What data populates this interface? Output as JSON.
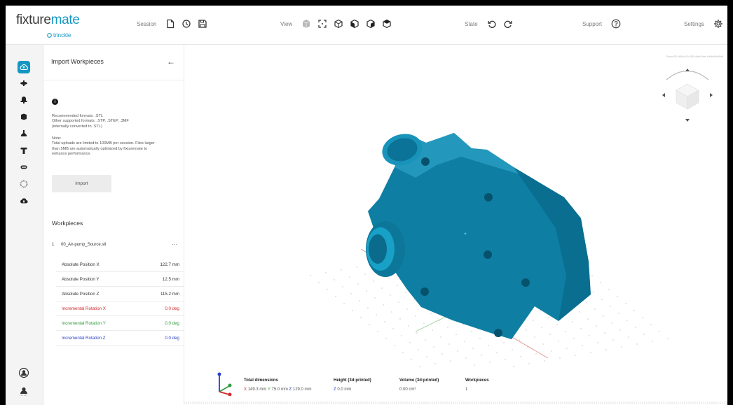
{
  "app": {
    "logo_main": "fixture",
    "logo_accent": "mate",
    "logo_sub": "trinckle"
  },
  "toolbar": {
    "session_label": "Session",
    "view_label": "View",
    "state_label": "State",
    "support_label": "Support",
    "settings_label": "Settings"
  },
  "panel": {
    "title": "Import Workpieces",
    "back_icon": "←",
    "info_icon": "i",
    "formats_lines": [
      "Recommended formats: .STL",
      "Other supported formats: .STP, .STEP, .3MF",
      "(internally converted to .STL)"
    ],
    "note_lines": [
      "Note:",
      "Total uploads are limited to 100MB per session. Files larger",
      "than 5MB are automatically optimized by fixturemate to",
      "enhance performance."
    ],
    "import_button": "Import",
    "workpieces_title": "Workpieces",
    "workpiece": {
      "index": "1",
      "name": "00_Air-pump_Source.stl",
      "menu": "···"
    },
    "properties": [
      {
        "label": "Absolute Position X",
        "value": "122.7 mm",
        "color": "#333333"
      },
      {
        "label": "Absolute Position Y",
        "value": "12.5 mm",
        "color": "#333333"
      },
      {
        "label": "Absolute Position Z",
        "value": "115.2 mm",
        "color": "#333333"
      },
      {
        "label": "Incremental Rotation X",
        "value": "0.0 deg",
        "color": "#d42a2a"
      },
      {
        "label": "Incremental Rotation Y",
        "value": "0.0 deg",
        "color": "#2f9d3c"
      },
      {
        "label": "Incremental Rotation Z",
        "value": "0.0 deg",
        "color": "#2a3fc8"
      }
    ]
  },
  "stats": {
    "total_dimensions_label": "Total dimensions",
    "x_prefix": "X",
    "x_value": "149.3 mm",
    "y_prefix": "Y",
    "y_value": "75.0 mm",
    "z_prefix": "Z",
    "z_value": "129.0 mm",
    "height_label": "Height (3d-printed)",
    "height_prefix": "Z",
    "height_value": "0.0 mm",
    "volume_label": "Volume (3d-printed)",
    "volume_value": "0.00 cm³",
    "workpieces_label": "Workpieces",
    "workpieces_value": "1"
  },
  "viewport": {
    "info_text": "Source3D: fb5e1a7b-4f20-4ba6-9eef-c0b4d6d0e5a8"
  },
  "colors": {
    "accent": "#1596c2",
    "part": "#0e7fa3"
  }
}
